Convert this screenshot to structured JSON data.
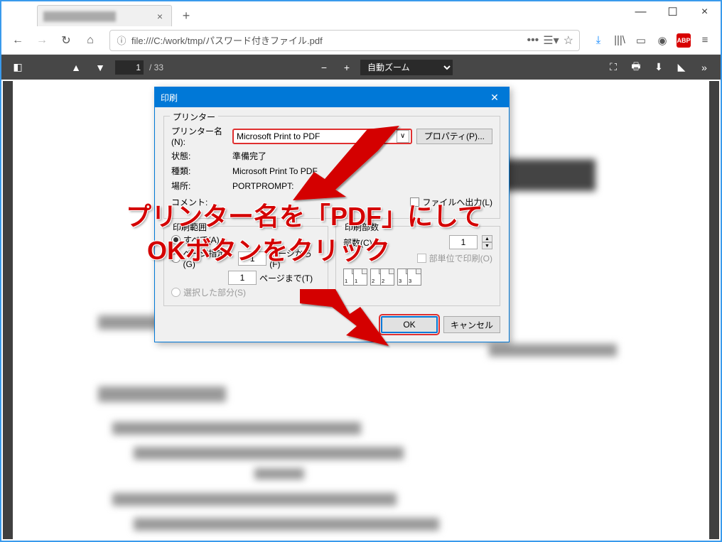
{
  "window": {
    "tab_close": "×",
    "new_tab": "+",
    "minimize": "—",
    "maximize": "☐",
    "close": "×"
  },
  "toolbar": {
    "url": "file:///C:/work/tmp/パスワード付きファイル.pdf",
    "dots": "•••"
  },
  "pdfbar": {
    "page": "1",
    "total": "/ 33",
    "zoom": "自動ズーム"
  },
  "dialog": {
    "title": "印刷",
    "printer_group": "プリンター",
    "printer_name_label": "プリンター名(N):",
    "printer_name_value": "Microsoft Print to PDF",
    "properties": "プロパティ(P)...",
    "status_label": "状態:",
    "status_value": "準備完了",
    "type_label": "種類:",
    "type_value": "Microsoft Print To PDF",
    "where_label": "場所:",
    "where_value": "PORTPROMPT:",
    "comment_label": "コメント:",
    "print_to_file": "ファイルへ出力(L)",
    "range_group": "印刷範囲",
    "range_all": "すべて(A)",
    "range_pages": "ページ指定(G)",
    "page_from_label": "ページから(F)",
    "page_to_label": "ページまで(T)",
    "page_from": "1",
    "page_to": "1",
    "range_selection": "選択した部分(S)",
    "copies_group": "印刷部数",
    "copies_label": "部数(C):",
    "copies_value": "1",
    "collate": "部単位で印刷(O)",
    "collate_1": "1",
    "collate_2": "2",
    "collate_3": "3",
    "ok": "OK",
    "cancel": "キャンセル"
  },
  "annotation": {
    "line1": "プリンター名を「PDF」にして",
    "line2": "OKボタンをクリック"
  }
}
